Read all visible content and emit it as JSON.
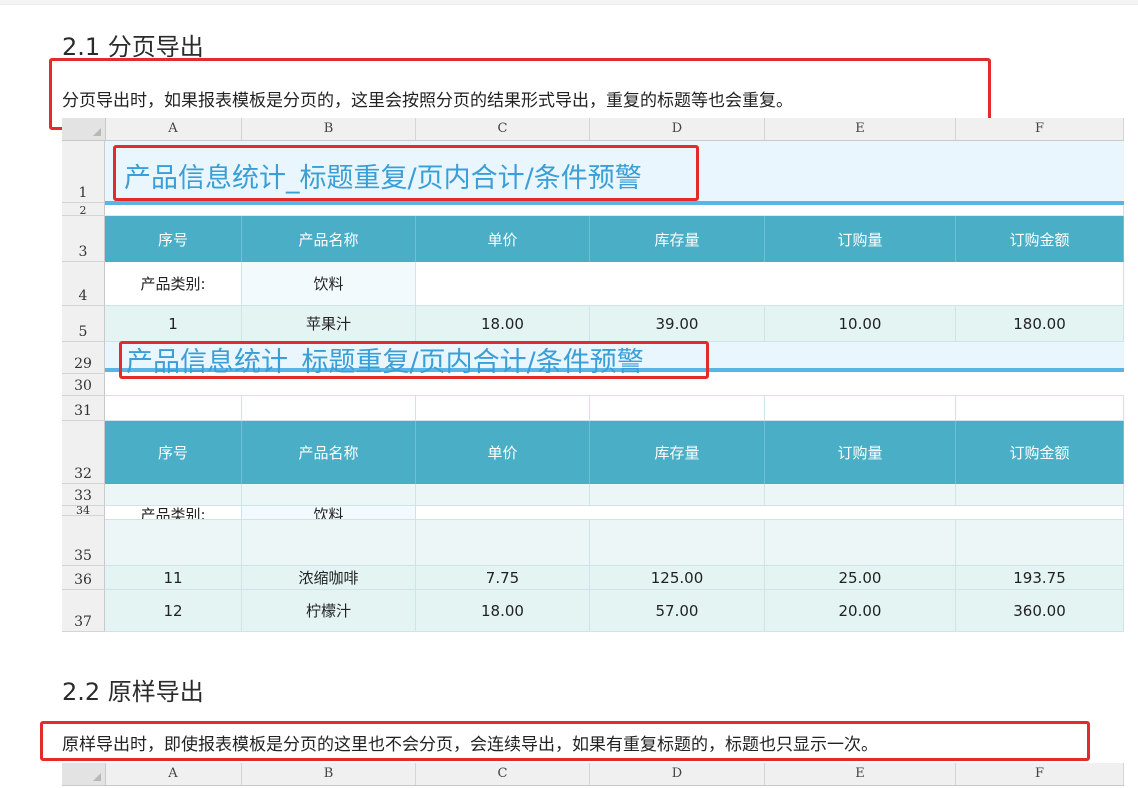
{
  "section1": {
    "heading": "2.1 分页导出",
    "description": "分页导出时，如果报表模板是分页的，这里会按照分页的结果形式导出，重复的标题等也会重复。"
  },
  "section2": {
    "heading": "2.2 原样导出",
    "description": "原样导出时，即使报表模板是分页的这里也不会分页，会连续导出，如果有重复标题的，标题也只显示一次。"
  },
  "sheet": {
    "columns": [
      "A",
      "B",
      "C",
      "D",
      "E",
      "F"
    ],
    "report_title": "产品信息统计_标题重复/页内合计/条件预警",
    "headers": [
      "序号",
      "产品名称",
      "单价",
      "库存量",
      "订购量",
      "订购金额"
    ],
    "category_label": "产品类别:",
    "category_value": "饮料",
    "row_numbers": [
      "1",
      "2",
      "3",
      "4",
      "5",
      "29",
      "30",
      "31",
      "32",
      "33",
      "34",
      "35",
      "36",
      "37"
    ],
    "rows": [
      {
        "row": "5",
        "values": [
          "1",
          "苹果汁",
          "18.00",
          "39.00",
          "10.00",
          "180.00"
        ]
      },
      {
        "row": "36",
        "values": [
          "11",
          "浓缩咖啡",
          "7.75",
          "125.00",
          "25.00",
          "193.75"
        ]
      },
      {
        "row": "37",
        "values": [
          "12",
          "柠檬汁",
          "18.00",
          "57.00",
          "20.00",
          "360.00"
        ]
      }
    ]
  },
  "colors": {
    "header_fill": "#4aaec6",
    "title_text": "#3a9fd6",
    "highlight_border": "#e32b2b",
    "data_row_fill": "#e4f4f3"
  }
}
